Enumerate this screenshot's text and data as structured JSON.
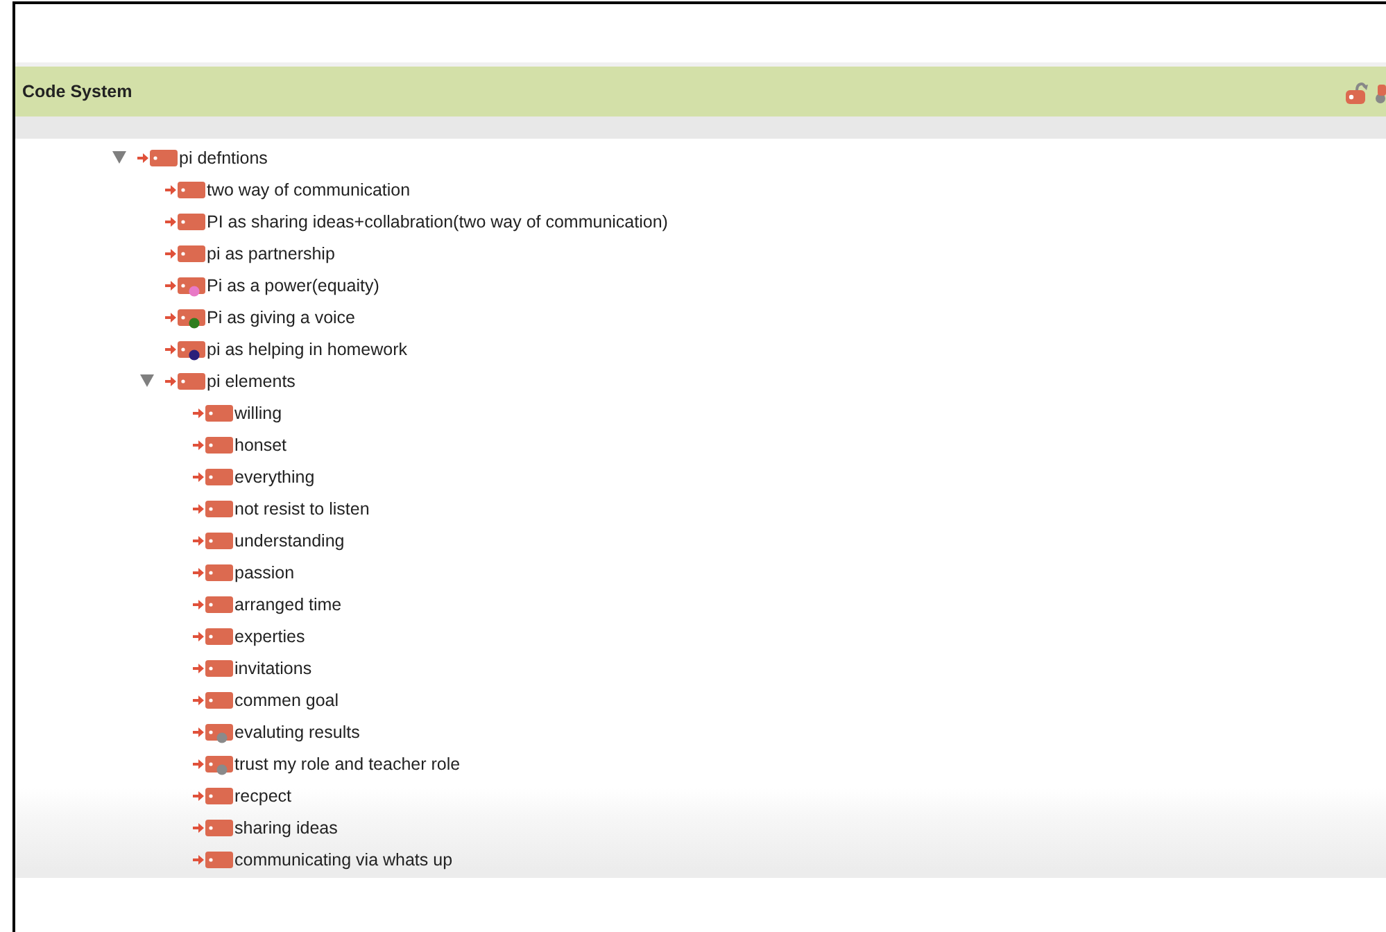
{
  "panel": {
    "title": "Code System"
  },
  "codes": [
    {
      "label": "pi defntions",
      "expanded": true,
      "children": [
        {
          "label": "two way of communication"
        },
        {
          "label": "PI as sharing ideas+collabration(two way of communication)"
        },
        {
          "label": "pi as partnership"
        },
        {
          "label": "Pi as a power(equaity)",
          "color": "#e879c6"
        },
        {
          "label": "Pi as giving a voice",
          "color": "#2e7d1e"
        },
        {
          "label": "pi as helping in homework",
          "color": "#2a1f7a"
        },
        {
          "label": "pi elements",
          "expanded": true,
          "children": [
            {
              "label": "willing"
            },
            {
              "label": "honset"
            },
            {
              "label": "everything"
            },
            {
              "label": "not resist to listen"
            },
            {
              "label": "understanding"
            },
            {
              "label": "passion"
            },
            {
              "label": "arranged time"
            },
            {
              "label": "experties"
            },
            {
              "label": "invitations"
            },
            {
              "label": "commen goal"
            },
            {
              "label": "evaluting results",
              "color": "#8a8a8a"
            },
            {
              "label": "trust my role and teacher role",
              "color": "#8a8a8a"
            },
            {
              "label": "recpect"
            },
            {
              "label": "sharing ideas"
            },
            {
              "label": "communicating via whats up"
            }
          ]
        }
      ]
    }
  ]
}
